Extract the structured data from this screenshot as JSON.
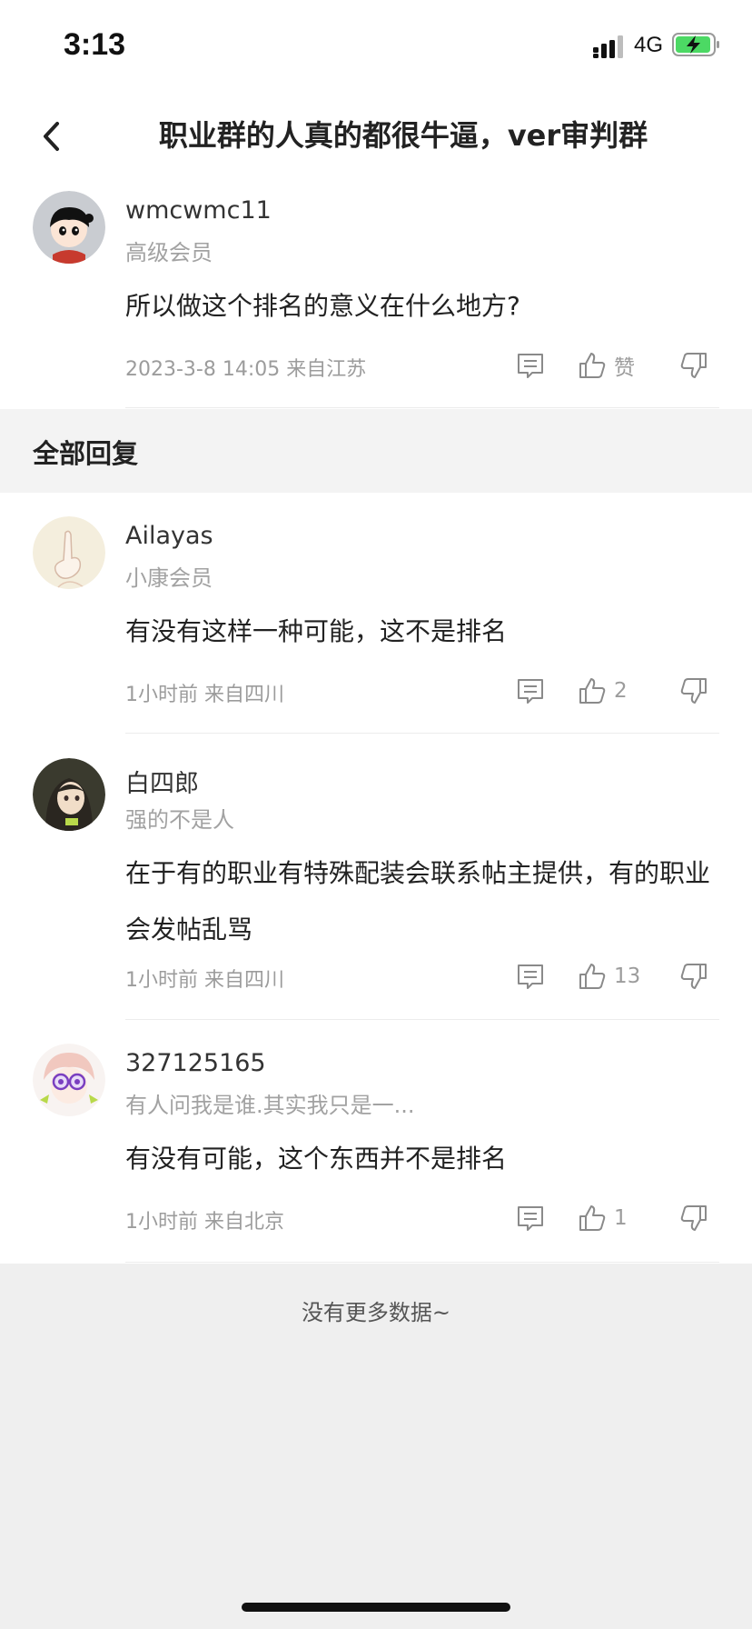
{
  "status": {
    "time": "3:13",
    "network": "4G"
  },
  "nav": {
    "title": "职业群的人真的都很牛逼，ver审判群"
  },
  "post": {
    "username": "wmcwmc11",
    "level": "高级会员",
    "content": "所以做这个排名的意义在什么地方?",
    "meta": "2023-3-8 14:05  来自江苏",
    "like_label": "赞"
  },
  "replies_section": {
    "title": "全部回复"
  },
  "replies": [
    {
      "username": "Ailayas",
      "level": "小康会员",
      "content": "有没有这样一种可能，这不是排名",
      "meta": "1小时前 来自四川",
      "likes": "2"
    },
    {
      "username": "白四郎",
      "level": "强的不是人",
      "content": "在于有的职业有特殊配装会联系帖主提供，有的职业会发帖乱骂",
      "meta": "1小时前 来自四川",
      "likes": "13"
    },
    {
      "username": "327125165",
      "level": "有人问我是谁.其实我只是一...",
      "content": "有没有可能，这个东西并不是排名",
      "meta": "1小时前 来自北京",
      "likes": "1"
    }
  ],
  "footer": {
    "text": "没有更多数据~"
  },
  "colors": {
    "background": "#efefef",
    "card": "#ffffff",
    "secondary_text": "#9c9c9c",
    "battery_fill": "#4cd964"
  }
}
